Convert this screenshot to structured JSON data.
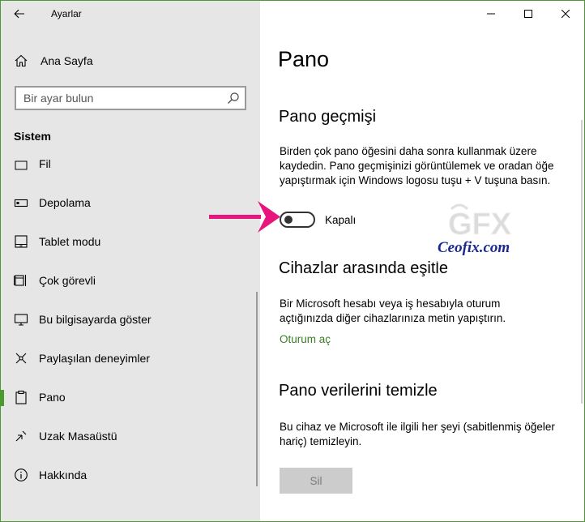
{
  "window": {
    "title": "Ayarlar",
    "accent": "#4a9b2f",
    "controls": {
      "minimize": "minimize-icon",
      "maximize": "maximize-icon",
      "close": "close-icon"
    }
  },
  "sidebar": {
    "back_icon": "back-arrow-icon",
    "home": {
      "label": "Ana Sayfa",
      "icon": "home-icon"
    },
    "search": {
      "placeholder": "Bir ayar bulun",
      "icon": "search-icon"
    },
    "section_title": "Sistem",
    "items": [
      {
        "label": "Fil",
        "icon": "partial-icon"
      },
      {
        "label": "Depolama",
        "icon": "storage-icon"
      },
      {
        "label": "Tablet modu",
        "icon": "tablet-icon"
      },
      {
        "label": "Çok görevli",
        "icon": "multitasking-icon"
      },
      {
        "label": "Bu bilgisayarda göster",
        "icon": "project-icon"
      },
      {
        "label": "Paylaşılan deneyimler",
        "icon": "shared-icon"
      },
      {
        "label": "Pano",
        "icon": "clipboard-icon",
        "active": true
      },
      {
        "label": "Uzak Masaüstü",
        "icon": "remote-desktop-icon"
      },
      {
        "label": "Hakkında",
        "icon": "info-icon"
      }
    ]
  },
  "main": {
    "title": "Pano",
    "history": {
      "heading": "Pano geçmişi",
      "description": "Birden çok pano öğesini daha sonra kullanmak üzere kaydedin. Pano geçmişinizi görüntülemek ve oradan öğe yapıştırmak için Windows logosu tuşu + V tuşuna basın.",
      "toggle_label": "Kapalı",
      "toggle_on": false
    },
    "sync": {
      "heading": "Cihazlar arasında eşitle",
      "description": "Bir Microsoft hesabı veya iş hesabıyla oturum açtığınızda diğer cihazlarınıza metin yapıştırın.",
      "link": "Oturum aç"
    },
    "clear": {
      "heading": "Pano verilerini temizle",
      "description": "Bu cihaz ve Microsoft ile ilgili her şeyi (sabitlenmiş öğeler hariç) temizleyin.",
      "button": "Sil"
    }
  },
  "overlay": {
    "arrow_color": "#e8167c",
    "watermark_logo": "GFX",
    "watermark_text": "Ceofix.com"
  }
}
